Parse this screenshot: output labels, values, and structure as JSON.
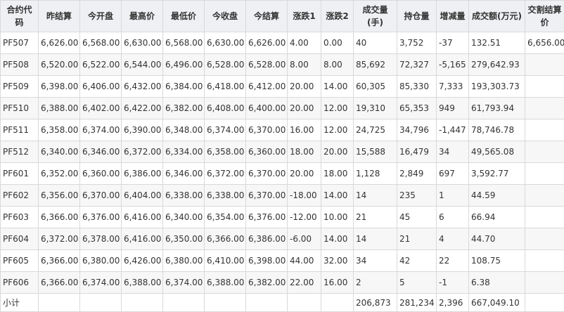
{
  "table": {
    "headers": [
      "合约代码",
      "昨结算",
      "今开盘",
      "最高价",
      "最低价",
      "今收盘",
      "今结算",
      "涨跌1",
      "涨跌2",
      "成交量(手)",
      "持仓量",
      "增减量",
      "成交额(万元)",
      "交割结算价"
    ],
    "rows": [
      [
        "PF507",
        "6,626.00",
        "6,568.00",
        "6,630.00",
        "6,568.00",
        "6,630.00",
        "6,626.00",
        "4.00",
        "0.00",
        "40",
        "3,752",
        "-37",
        "132.51",
        "6,656.00"
      ],
      [
        "PF508",
        "6,520.00",
        "6,522.00",
        "6,544.00",
        "6,496.00",
        "6,528.00",
        "6,528.00",
        "8.00",
        "8.00",
        "85,692",
        "72,327",
        "-5,165",
        "279,642.93",
        ""
      ],
      [
        "PF509",
        "6,398.00",
        "6,406.00",
        "6,432.00",
        "6,384.00",
        "6,418.00",
        "6,412.00",
        "20.00",
        "14.00",
        "60,305",
        "85,330",
        "7,333",
        "193,303.73",
        ""
      ],
      [
        "PF510",
        "6,388.00",
        "6,402.00",
        "6,422.00",
        "6,382.00",
        "6,408.00",
        "6,400.00",
        "20.00",
        "12.00",
        "19,310",
        "65,353",
        "949",
        "61,793.94",
        ""
      ],
      [
        "PF511",
        "6,358.00",
        "6,374.00",
        "6,390.00",
        "6,348.00",
        "6,374.00",
        "6,370.00",
        "16.00",
        "12.00",
        "24,725",
        "34,796",
        "-1,447",
        "78,746.78",
        ""
      ],
      [
        "PF512",
        "6,340.00",
        "6,346.00",
        "6,372.00",
        "6,334.00",
        "6,358.00",
        "6,360.00",
        "18.00",
        "20.00",
        "15,588",
        "16,479",
        "34",
        "49,565.08",
        ""
      ],
      [
        "PF601",
        "6,352.00",
        "6,360.00",
        "6,386.00",
        "6,346.00",
        "6,372.00",
        "6,370.00",
        "20.00",
        "18.00",
        "1,128",
        "2,849",
        "697",
        "3,592.77",
        ""
      ],
      [
        "PF602",
        "6,356.00",
        "6,370.00",
        "6,404.00",
        "6,338.00",
        "6,338.00",
        "6,370.00",
        "-18.00",
        "14.00",
        "14",
        "235",
        "1",
        "44.59",
        ""
      ],
      [
        "PF603",
        "6,366.00",
        "6,376.00",
        "6,416.00",
        "6,340.00",
        "6,354.00",
        "6,376.00",
        "-12.00",
        "10.00",
        "21",
        "45",
        "6",
        "66.94",
        ""
      ],
      [
        "PF604",
        "6,372.00",
        "6,378.00",
        "6,416.00",
        "6,350.00",
        "6,366.00",
        "6,386.00",
        "-6.00",
        "14.00",
        "14",
        "21",
        "4",
        "44.70",
        ""
      ],
      [
        "PF605",
        "6,366.00",
        "6,380.00",
        "6,426.00",
        "6,380.00",
        "6,410.00",
        "6,398.00",
        "44.00",
        "32.00",
        "34",
        "42",
        "22",
        "108.75",
        ""
      ],
      [
        "PF606",
        "6,366.00",
        "6,374.00",
        "6,388.00",
        "6,374.00",
        "6,388.00",
        "6,382.00",
        "22.00",
        "16.00",
        "2",
        "5",
        "-1",
        "6.38",
        ""
      ]
    ],
    "footer": [
      "小计",
      "",
      "",
      "",
      "",
      "",
      "",
      "",
      "",
      "206,873",
      "281,234",
      "2,396",
      "667,049.10",
      ""
    ]
  }
}
